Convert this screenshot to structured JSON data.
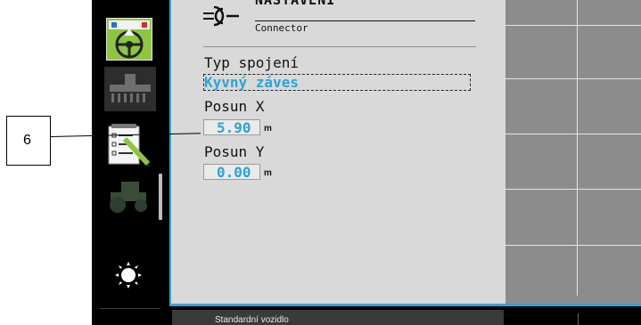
{
  "header": {
    "title": "NASTAVENÍ",
    "subtitle": "Connector"
  },
  "form": {
    "coupling_type": {
      "label": "Typ spojení",
      "value": "Kyvný záves"
    },
    "offset_x": {
      "label": "Posun X",
      "value": "5.90",
      "unit": "m"
    },
    "offset_y": {
      "label": "Posun Y",
      "value": "0.00",
      "unit": "m"
    }
  },
  "footer": {
    "vehicle": "Standardní vozidlo"
  },
  "callout": {
    "number": "6"
  },
  "sidebar": {
    "items": [
      {
        "icon": "steering-wheel-icon"
      },
      {
        "icon": "implement-icon"
      },
      {
        "icon": "checklist-edit-icon"
      },
      {
        "icon": "tractor-icon"
      },
      {
        "icon": "brightness-icon"
      }
    ]
  },
  "colors": {
    "accent": "#2aa4d8",
    "frame": "#3aa1d6",
    "panel": "#d9d9d9",
    "grid": "#8c8c8c"
  }
}
